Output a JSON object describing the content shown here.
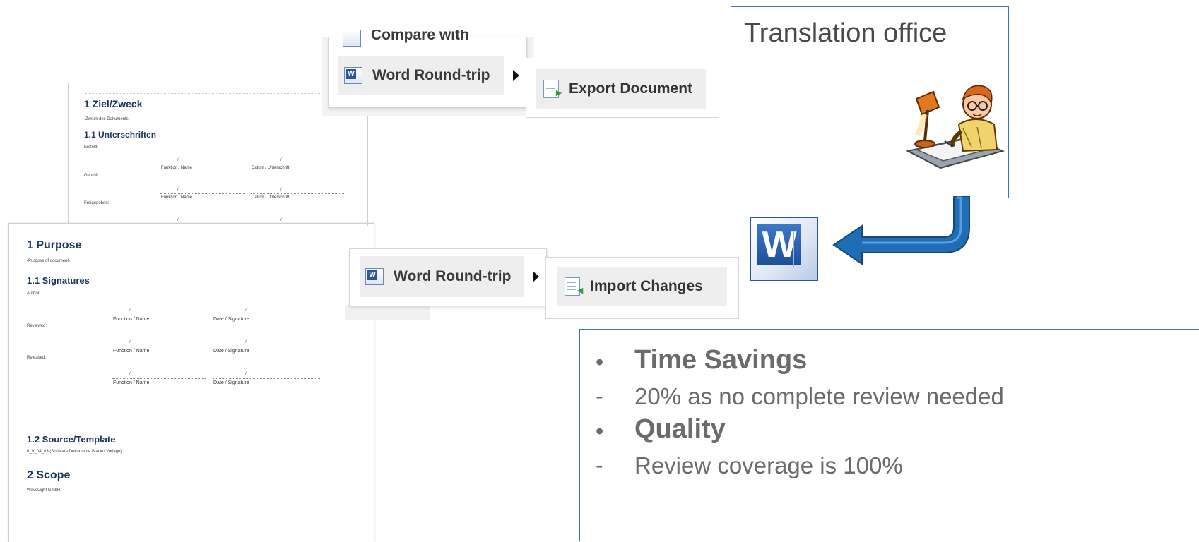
{
  "doc_german": {
    "h1": "1 Ziel/Zweck",
    "purpose": "‹Zweck des Dokuments›",
    "h2": "1.1 Unterschriften",
    "roles": [
      "Erstellt:",
      "Geprüft:",
      "Freigegeben:"
    ],
    "col1": "Funktion / Name",
    "col2": "Datum / Unterschrift"
  },
  "doc_english": {
    "h1": "1 Purpose",
    "purpose": "‹Purpose of document›",
    "h2": "1.1 Signatures",
    "roles": [
      "Author:",
      "Reviewed:",
      "Released:"
    ],
    "col1": "Function / Name",
    "col2": "Date / Signature",
    "h2b": "1.2 Source/Template",
    "template": "6_V_04_03 (Software Dokumente Blanko Vorlage)",
    "h1b": "2 Scope",
    "scope": "WaveLight GmbH"
  },
  "separator": "/",
  "menu_top": {
    "compare_with": "Compare with",
    "word_round_trip": "Word Round-trip",
    "export": "Export Document"
  },
  "menu_bottom": {
    "word_round_trip": "Word Round-trip",
    "import": "Import Changes"
  },
  "word_icon_letter": "W",
  "office": {
    "title": "Translation office"
  },
  "benefits": {
    "items": [
      {
        "marker": "•",
        "text": "Time Savings",
        "bold": true
      },
      {
        "marker": "-",
        "text": "20% as no complete review needed",
        "bold": false
      },
      {
        "marker": "•",
        "text": "Quality",
        "bold": true
      },
      {
        "marker": "-",
        "text": "Review coverage is 100%",
        "bold": false
      }
    ]
  },
  "colors": {
    "heading": "#17365d",
    "frame": "#3877b6",
    "arrow": "#1f6db5",
    "word_blue": "#2b579a",
    "benefit_text": "#6b6b6b"
  }
}
